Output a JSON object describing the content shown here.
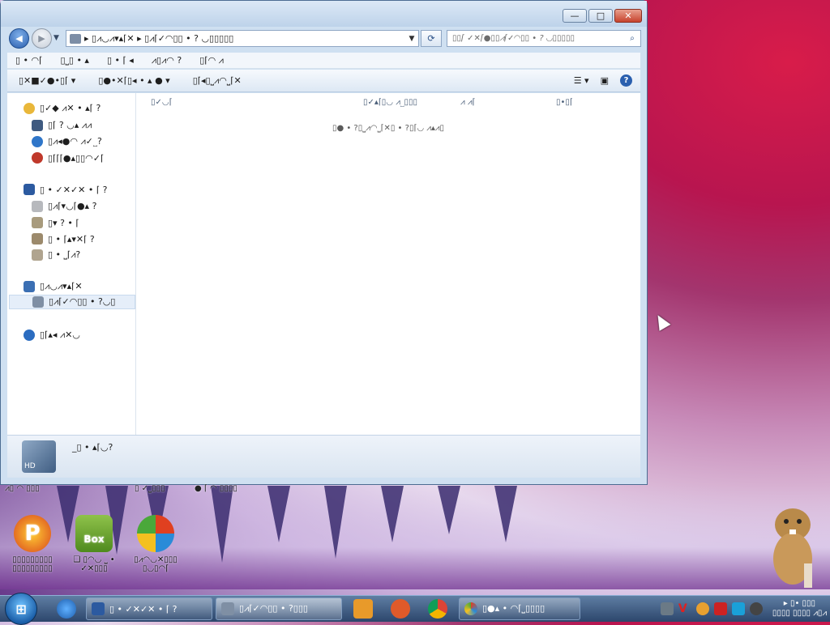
{
  "window": {
    "title_buttons": {
      "minimize": "—",
      "maximize": "□",
      "close": "✕"
    },
    "address": "▸ ▯⩘◡⩘▾▴⌈✕ ▸ ▯⩘⌈✓◠▯▯ • ? ◡▯▯▯▯▯",
    "search_placeholder": "▯▯⌈ ✓✕⌈●▯▯⩘⌈✓◠▯▯ • ? ◡▯▯▯▯▯",
    "menu": [
      "▯ • ◠⌈",
      "▯⎵▯ • ▴",
      "▯ • ⌈ ◂",
      "⩘▯⩘◠ ?",
      "▯⌈◠ ⩘"
    ],
    "toolbar": [
      "▯✕■✓●•▯⌈ ▾",
      "▯●•✕⌈▯◂ • ▴ ● ▾",
      "▯⌈◂▯⎵⩘◠⎵⌈✕"
    ],
    "help": "?",
    "columns": [
      "▯✓◡⌈",
      "▯✓▴⌈▯◡ ⩘⎵▯▯▯",
      "⩘ ⩘⌈",
      "▯•▯⌈"
    ],
    "empty_text": "▯● • ?▯⎵⩘◠⎵⌈✕▯ • ?▯⌈◡ ⩘▴⩘▯",
    "nav": {
      "favorites": "▯✓◆ ⩘✕ • ▴⌈ ?",
      "fav_items": [
        "▯⌈ ? ◡▴ ⩘⩘",
        "▯⩘◂●◠ ⩘✓⎵?",
        "▯⌈⌈⌈●▴▯▯◠✓⌈"
      ],
      "libraries": "▯ • ✓✕✓✕ • ⌈ ?",
      "lib_items": [
        "▯⩘⌈▾◡⌈●▴ ?",
        "▯▾ ? • ⌈",
        "▯ • ⌈▴▾✕⌈ ?",
        "▯ • ⎵⌈⩘?"
      ],
      "computer": "▯⩘◡⩘▾▴⌈✕",
      "computer_items": [
        "▯⩘⌈✓◠▯▯ • ?◡▯"
      ],
      "network": "▯⌈▴◂ ⩘✕◡"
    },
    "details_text": "_▯ • ▴⌈◡?",
    "details_icon": "HD"
  },
  "desktop": {
    "top_labels": [
      "⩘▯ ◠ ▯▯▯",
      "▯ ✓⎵▯▯▯",
      "● ⌈ ◠ ▯▯▯▯"
    ],
    "icons": [
      {
        "label": "▯▯▯▯▯▯▯▯▯ ▯▯▯▯▯▯▯▯▯",
        "icon": "p-icon",
        "color": "#d9461c"
      },
      {
        "label": "❑ ▯◠◡ ⎵ • ✓✕▯▯▯",
        "icon": "box-icon",
        "color": "#6aa52a",
        "text": "Box"
      },
      {
        "label": "▯⩘◠◡✕▯▯▯ ▯◡▯◠⌈",
        "icon": "media-icon",
        "color": "#e04020"
      }
    ]
  },
  "taskbar": {
    "start": "⊞",
    "buttons": [
      {
        "label": "▯ • ✓✕✓✕ • ⌈ ?",
        "icon": "library-icon"
      },
      {
        "label": "▯⩘⌈✓◠▯▯ • ?▯▯▯",
        "icon": "drive-icon"
      },
      {
        "label": "▯●▴ • ◠⌈⎵▯▯▯▯",
        "icon": "paint-icon"
      }
    ],
    "clock_time": "▸ ▯• ▯▯▯",
    "clock_date": "▯▯▯▯ ▯▯▯▯ ⩘▯⩘"
  }
}
